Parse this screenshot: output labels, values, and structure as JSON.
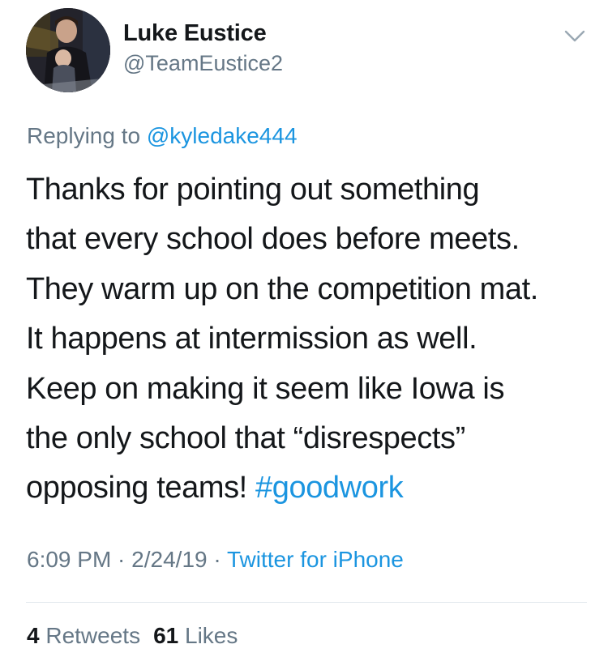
{
  "author": {
    "display_name": "Luke Eustice",
    "handle": "@TeamEustice2"
  },
  "reply": {
    "prefix": "Replying to",
    "to_handle": "@kyledake444"
  },
  "tweet": {
    "lines": [
      "Thanks for pointing out something",
      "that every school does before meets.",
      "They warm up on the competition mat.",
      "It happens at intermission as well.",
      "Keep on making it seem like Iowa is",
      "the only school that “disrespects”",
      "opposing teams! "
    ],
    "hashtag": "#goodwork"
  },
  "meta": {
    "time": "6:09 PM",
    "separator": " · ",
    "date": "2/24/19",
    "source": "Twitter for iPhone"
  },
  "stats": {
    "retweets_count": "4",
    "retweets_label": "Retweets",
    "likes_count": "61",
    "likes_label": "Likes"
  },
  "icons": {
    "menu": "chevron-down-icon",
    "avatar": "profile-photo"
  },
  "colors": {
    "link": "#1b95e0",
    "secondary_text": "#657786",
    "primary_text": "#14171a",
    "divider": "#e1e8ed"
  }
}
